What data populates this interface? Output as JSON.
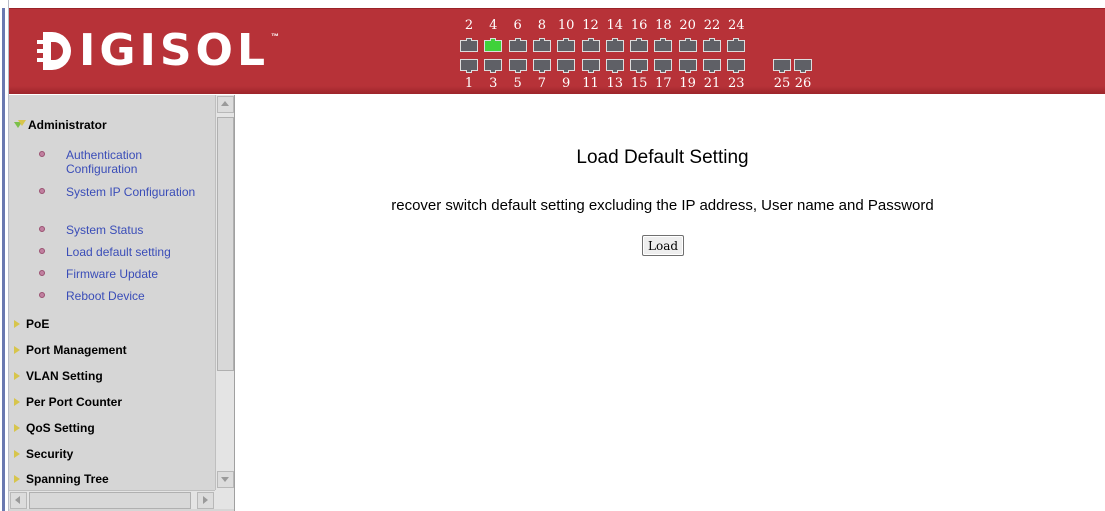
{
  "brand": {
    "logo_text": "IGISOL",
    "trademark": "™",
    "header_color": "#b73238"
  },
  "ports": {
    "top_numbers": [
      "2",
      "4",
      "6",
      "8",
      "10",
      "12",
      "14",
      "16",
      "18",
      "20",
      "22",
      "24"
    ],
    "bottom_numbers": [
      "1",
      "3",
      "5",
      "7",
      "9",
      "11",
      "13",
      "15",
      "17",
      "19",
      "21",
      "23"
    ],
    "sfp_numbers": [
      "25",
      "26"
    ],
    "active_port": "4",
    "active_color": "#3fd13a"
  },
  "sidebar": {
    "categories": [
      {
        "label": "Administrator",
        "expanded": true
      },
      {
        "label": "PoE"
      },
      {
        "label": "Port Management"
      },
      {
        "label": "VLAN Setting"
      },
      {
        "label": "Per Port Counter"
      },
      {
        "label": "QoS Setting"
      },
      {
        "label": "Security"
      },
      {
        "label": "Spanning Tree"
      }
    ],
    "admin_items": [
      {
        "label": "Authentication Configuration"
      },
      {
        "label": "System IP Configuration"
      },
      {
        "label": "System Status"
      },
      {
        "label": "Load default setting"
      },
      {
        "label": "Firmware Update"
      },
      {
        "label": "Reboot Device"
      }
    ]
  },
  "main": {
    "title": "Load Default Setting",
    "description": "recover switch default setting excluding the IP address, User name and Password",
    "load_button": "Load"
  }
}
